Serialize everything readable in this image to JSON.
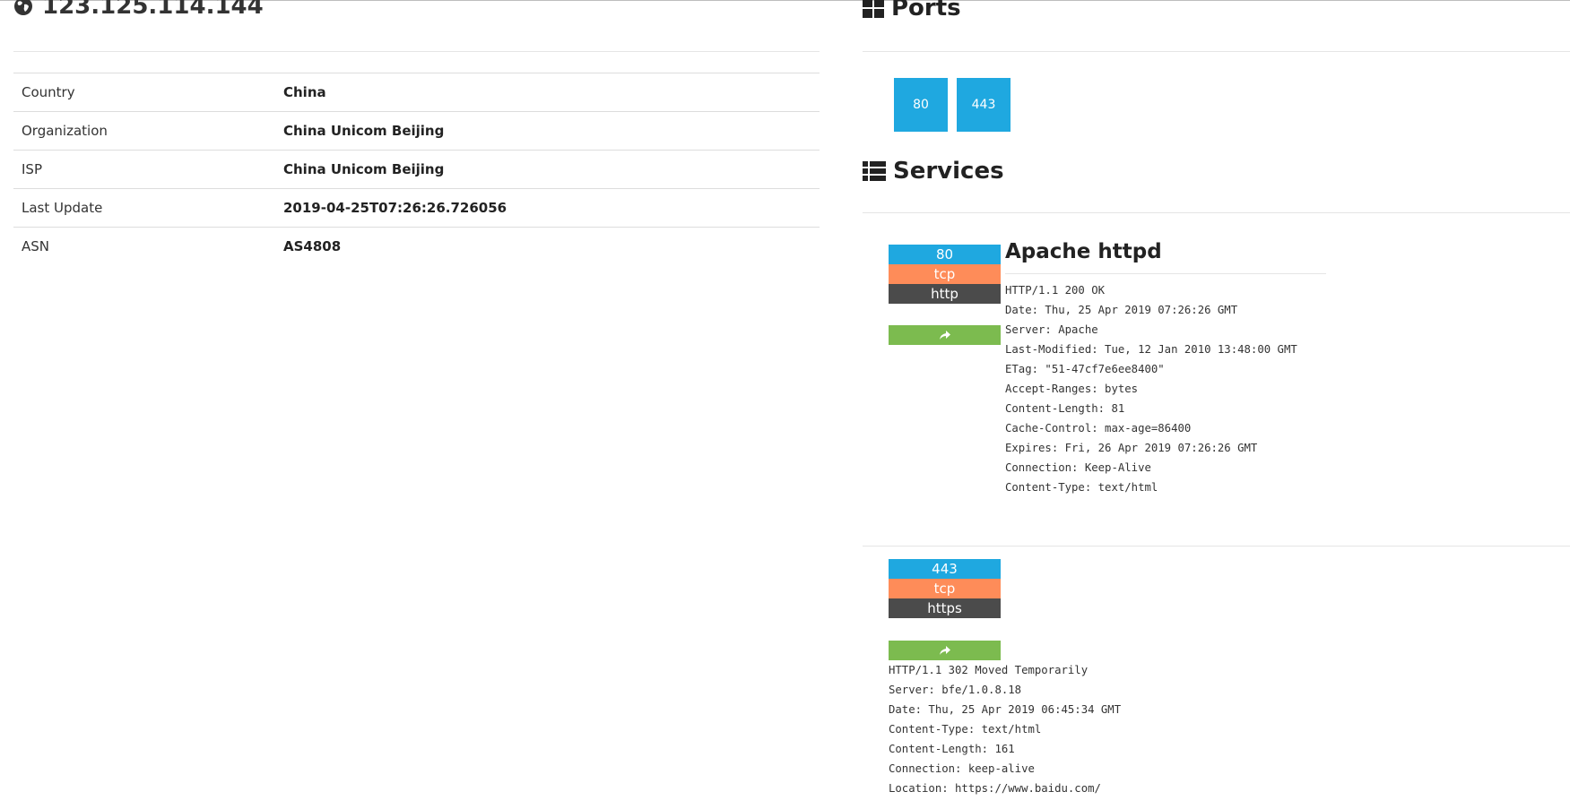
{
  "host": {
    "ip": "123.125.114.144",
    "icon": "globe-icon",
    "rows": [
      {
        "key": "Country",
        "value": "China"
      },
      {
        "key": "Organization",
        "value": "China Unicom Beijing"
      },
      {
        "key": "ISP",
        "value": "China Unicom Beijing"
      },
      {
        "key": "Last Update",
        "value": "2019-04-25T07:26:26.726056"
      },
      {
        "key": "ASN",
        "value": "AS4808"
      }
    ]
  },
  "ports": {
    "title": "Ports",
    "icon": "th-large-icon",
    "list": [
      "80",
      "443"
    ],
    "tile_color": "#1fa8e0"
  },
  "services": {
    "title": "Services",
    "icon": "th-list-icon",
    "items": [
      {
        "port": "80",
        "transport": "tcp",
        "module": "http",
        "product": "Apache httpd",
        "banner": "HTTP/1.1 200 OK\nDate: Thu, 25 Apr 2019 07:26:26 GMT\nServer: Apache\nLast-Modified: Tue, 12 Jan 2010 13:48:00 GMT\nETag: \"51-47cf7e6ee8400\"\nAccept-Ranges: bytes\nContent-Length: 81\nCache-Control: max-age=86400\nExpires: Fri, 26 Apr 2019 07:26:26 GMT\nConnection: Keep-Alive\nContent-Type: text/html"
      },
      {
        "port": "443",
        "transport": "tcp",
        "module": "https",
        "banner": "HTTP/1.1 302 Moved Temporarily\nServer: bfe/1.0.8.18\nDate: Thu, 25 Apr 2019 06:45:34 GMT\nContent-Type: text/html\nContent-Length: 161\nConnection: keep-alive\nLocation: https://www.baidu.com/"
      }
    ],
    "colors": {
      "port": "#1fa8e0",
      "transport": "#fe8c59",
      "module": "#4b4b4b",
      "share": "#7cbb4f"
    },
    "share_icon": "share-icon"
  }
}
